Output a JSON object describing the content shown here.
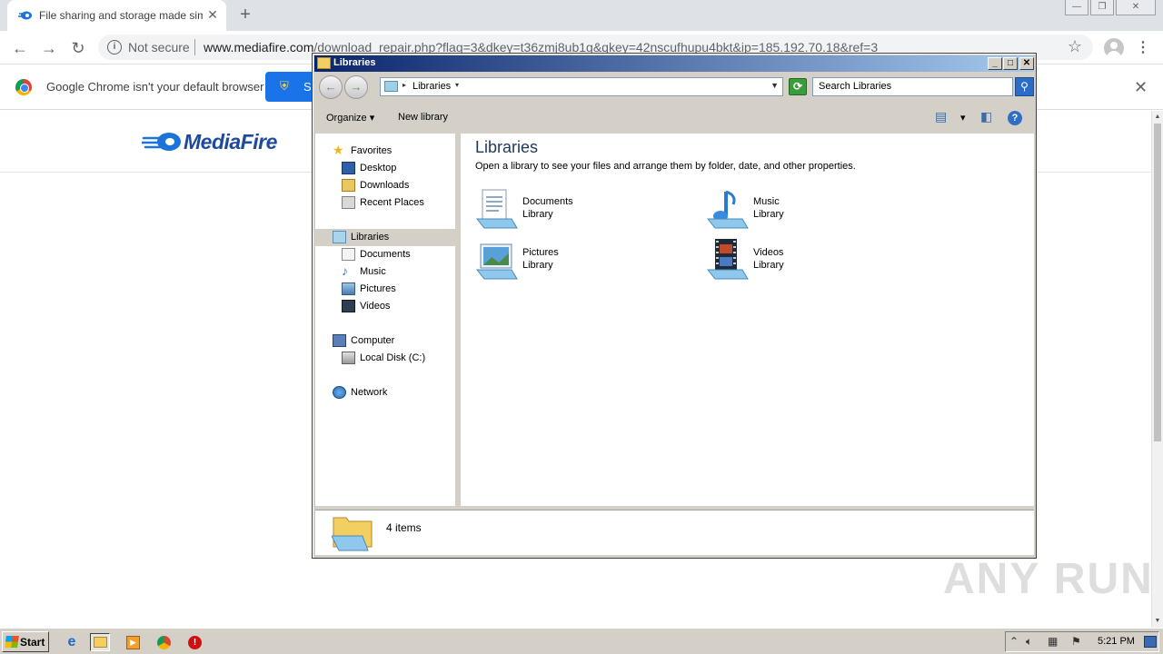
{
  "browser": {
    "tab_title": "File sharing and storage made simple",
    "omnibox": {
      "security_label": "Not secure",
      "url_host": "www.mediafire.com",
      "url_path": "/download_repair.php?flag=3&dkey=t36zmj8ub1g&qkey=42nscufhupu4bkt&ip=185.192.70.18&ref=3"
    },
    "infobar": {
      "message": "Google Chrome isn't your default browser",
      "button_label": "S"
    }
  },
  "page": {
    "logo_text": "MediaFire"
  },
  "explorer": {
    "window_title": "Libraries",
    "address_crumb": "Libraries",
    "search_placeholder": "Search Libraries",
    "commands": {
      "organize": "Organize",
      "new_library": "New library"
    },
    "nav": {
      "favorites": "Favorites",
      "desktop": "Desktop",
      "downloads": "Downloads",
      "recent_places": "Recent Places",
      "libraries": "Libraries",
      "documents": "Documents",
      "music": "Music",
      "pictures": "Pictures",
      "videos": "Videos",
      "computer": "Computer",
      "local_disk": "Local Disk (C:)",
      "network": "Network"
    },
    "content": {
      "title": "Libraries",
      "description": "Open a library to see your files and arrange them by folder, date, and other properties.",
      "items": [
        {
          "name": "Documents",
          "type": "Library",
          "icon": "documents-library-icon"
        },
        {
          "name": "Music",
          "type": "Library",
          "icon": "music-library-icon"
        },
        {
          "name": "Pictures",
          "type": "Library",
          "icon": "pictures-library-icon"
        },
        {
          "name": "Videos",
          "type": "Library",
          "icon": "videos-library-icon"
        }
      ]
    },
    "status": "4 items"
  },
  "taskbar": {
    "start_label": "Start",
    "clock": "5:21 PM"
  },
  "watermark": "ANY RUN",
  "colors": {
    "title_bar_start": "#0a246a",
    "title_bar_end": "#a6caf0",
    "infobar_button": "#1a73e8",
    "mediafire_blue": "#1d4a9c"
  }
}
